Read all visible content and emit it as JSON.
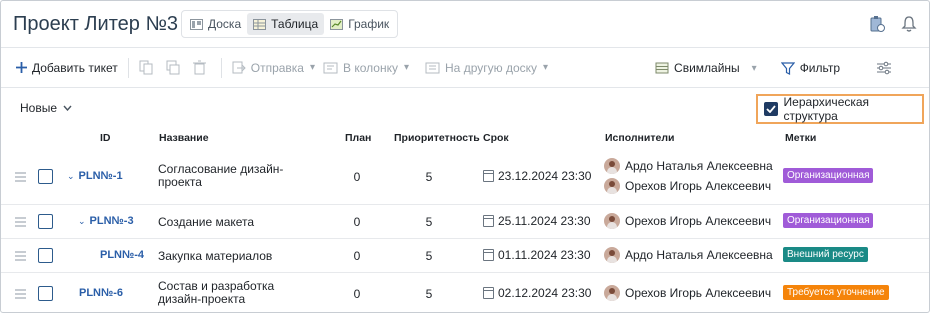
{
  "header": {
    "title": "Проект Литер №3",
    "views": [
      {
        "label": "Доска",
        "icon": "board-icon"
      },
      {
        "label": "Таблица",
        "icon": "table-icon"
      },
      {
        "label": "График",
        "icon": "chart-icon"
      }
    ]
  },
  "toolbar": {
    "add": "Добавить тикет",
    "send": "Отправка",
    "to_column": "В колонку",
    "to_board": "На другую доску",
    "swimlanes": "Свимлайны",
    "filter": "Фильтр"
  },
  "group": {
    "label": "Новые"
  },
  "hierarchy": {
    "label": "Иерархическая структура",
    "checked": true
  },
  "columns": {
    "id": "ID",
    "name": "Название",
    "plan": "План",
    "priority": "Приоритетность",
    "due": "Срок",
    "assignees": "Исполнители",
    "tags": "Метки"
  },
  "rows": [
    {
      "id": "PLN№-1",
      "name": "Согласование дизайн-проекта",
      "plan": "0",
      "priority": "5",
      "due": "23.12.2024 23:30",
      "assignees": [
        "Ардо Наталья Алексеевна",
        "Орехов Игорь Алексеевич"
      ],
      "tag": "Организационная",
      "tag_color": "#a05bd8"
    },
    {
      "id": "PLN№-3",
      "name": "Создание макета",
      "plan": "0",
      "priority": "5",
      "due": "25.11.2024 23:30",
      "assignees": [
        "Орехов Игорь Алексеевич"
      ],
      "tag": "Организационная",
      "tag_color": "#a05bd8"
    },
    {
      "id": "PLN№-4",
      "name": "Закупка материалов",
      "plan": "0",
      "priority": "5",
      "due": "01.11.2024 23:30",
      "assignees": [
        "Ардо Наталья Алексеевна"
      ],
      "tag": "Внешний ресурс",
      "tag_color": "#1a8a86"
    },
    {
      "id": "PLN№-6",
      "name": "Состав и разработка дизайн-проекта",
      "plan": "0",
      "priority": "5",
      "due": "02.12.2024 23:30",
      "assignees": [
        "Орехов Игорь Алексеевич"
      ],
      "tag": "Требуется уточнение",
      "tag_color": "#f5840a"
    }
  ]
}
